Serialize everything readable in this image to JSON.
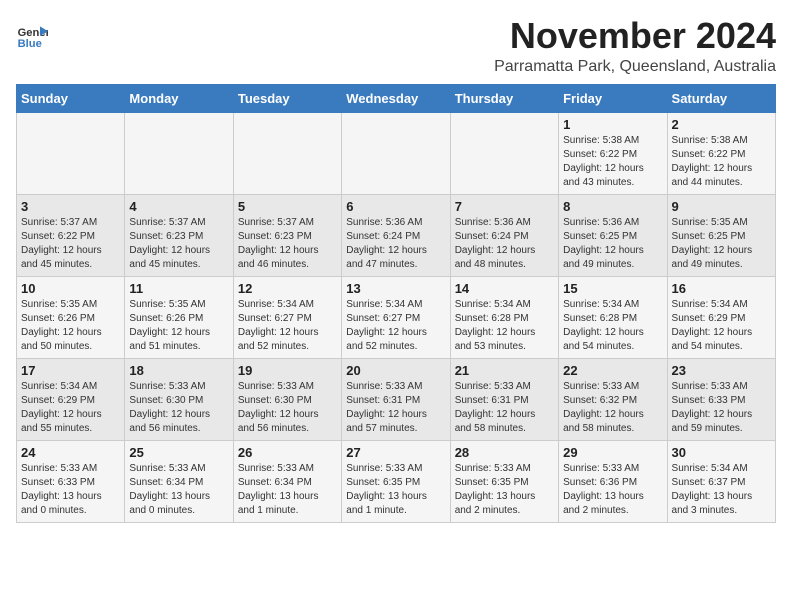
{
  "header": {
    "logo_line1": "General",
    "logo_line2": "Blue",
    "month": "November 2024",
    "location": "Parramatta Park, Queensland, Australia"
  },
  "days_of_week": [
    "Sunday",
    "Monday",
    "Tuesday",
    "Wednesday",
    "Thursday",
    "Friday",
    "Saturday"
  ],
  "weeks": [
    [
      {
        "day": "",
        "info": ""
      },
      {
        "day": "",
        "info": ""
      },
      {
        "day": "",
        "info": ""
      },
      {
        "day": "",
        "info": ""
      },
      {
        "day": "",
        "info": ""
      },
      {
        "day": "1",
        "info": "Sunrise: 5:38 AM\nSunset: 6:22 PM\nDaylight: 12 hours\nand 43 minutes."
      },
      {
        "day": "2",
        "info": "Sunrise: 5:38 AM\nSunset: 6:22 PM\nDaylight: 12 hours\nand 44 minutes."
      }
    ],
    [
      {
        "day": "3",
        "info": "Sunrise: 5:37 AM\nSunset: 6:22 PM\nDaylight: 12 hours\nand 45 minutes."
      },
      {
        "day": "4",
        "info": "Sunrise: 5:37 AM\nSunset: 6:23 PM\nDaylight: 12 hours\nand 45 minutes."
      },
      {
        "day": "5",
        "info": "Sunrise: 5:37 AM\nSunset: 6:23 PM\nDaylight: 12 hours\nand 46 minutes."
      },
      {
        "day": "6",
        "info": "Sunrise: 5:36 AM\nSunset: 6:24 PM\nDaylight: 12 hours\nand 47 minutes."
      },
      {
        "day": "7",
        "info": "Sunrise: 5:36 AM\nSunset: 6:24 PM\nDaylight: 12 hours\nand 48 minutes."
      },
      {
        "day": "8",
        "info": "Sunrise: 5:36 AM\nSunset: 6:25 PM\nDaylight: 12 hours\nand 49 minutes."
      },
      {
        "day": "9",
        "info": "Sunrise: 5:35 AM\nSunset: 6:25 PM\nDaylight: 12 hours\nand 49 minutes."
      }
    ],
    [
      {
        "day": "10",
        "info": "Sunrise: 5:35 AM\nSunset: 6:26 PM\nDaylight: 12 hours\nand 50 minutes."
      },
      {
        "day": "11",
        "info": "Sunrise: 5:35 AM\nSunset: 6:26 PM\nDaylight: 12 hours\nand 51 minutes."
      },
      {
        "day": "12",
        "info": "Sunrise: 5:34 AM\nSunset: 6:27 PM\nDaylight: 12 hours\nand 52 minutes."
      },
      {
        "day": "13",
        "info": "Sunrise: 5:34 AM\nSunset: 6:27 PM\nDaylight: 12 hours\nand 52 minutes."
      },
      {
        "day": "14",
        "info": "Sunrise: 5:34 AM\nSunset: 6:28 PM\nDaylight: 12 hours\nand 53 minutes."
      },
      {
        "day": "15",
        "info": "Sunrise: 5:34 AM\nSunset: 6:28 PM\nDaylight: 12 hours\nand 54 minutes."
      },
      {
        "day": "16",
        "info": "Sunrise: 5:34 AM\nSunset: 6:29 PM\nDaylight: 12 hours\nand 54 minutes."
      }
    ],
    [
      {
        "day": "17",
        "info": "Sunrise: 5:34 AM\nSunset: 6:29 PM\nDaylight: 12 hours\nand 55 minutes."
      },
      {
        "day": "18",
        "info": "Sunrise: 5:33 AM\nSunset: 6:30 PM\nDaylight: 12 hours\nand 56 minutes."
      },
      {
        "day": "19",
        "info": "Sunrise: 5:33 AM\nSunset: 6:30 PM\nDaylight: 12 hours\nand 56 minutes."
      },
      {
        "day": "20",
        "info": "Sunrise: 5:33 AM\nSunset: 6:31 PM\nDaylight: 12 hours\nand 57 minutes."
      },
      {
        "day": "21",
        "info": "Sunrise: 5:33 AM\nSunset: 6:31 PM\nDaylight: 12 hours\nand 58 minutes."
      },
      {
        "day": "22",
        "info": "Sunrise: 5:33 AM\nSunset: 6:32 PM\nDaylight: 12 hours\nand 58 minutes."
      },
      {
        "day": "23",
        "info": "Sunrise: 5:33 AM\nSunset: 6:33 PM\nDaylight: 12 hours\nand 59 minutes."
      }
    ],
    [
      {
        "day": "24",
        "info": "Sunrise: 5:33 AM\nSunset: 6:33 PM\nDaylight: 13 hours\nand 0 minutes."
      },
      {
        "day": "25",
        "info": "Sunrise: 5:33 AM\nSunset: 6:34 PM\nDaylight: 13 hours\nand 0 minutes."
      },
      {
        "day": "26",
        "info": "Sunrise: 5:33 AM\nSunset: 6:34 PM\nDaylight: 13 hours\nand 1 minute."
      },
      {
        "day": "27",
        "info": "Sunrise: 5:33 AM\nSunset: 6:35 PM\nDaylight: 13 hours\nand 1 minute."
      },
      {
        "day": "28",
        "info": "Sunrise: 5:33 AM\nSunset: 6:35 PM\nDaylight: 13 hours\nand 2 minutes."
      },
      {
        "day": "29",
        "info": "Sunrise: 5:33 AM\nSunset: 6:36 PM\nDaylight: 13 hours\nand 2 minutes."
      },
      {
        "day": "30",
        "info": "Sunrise: 5:34 AM\nSunset: 6:37 PM\nDaylight: 13 hours\nand 3 minutes."
      }
    ]
  ]
}
